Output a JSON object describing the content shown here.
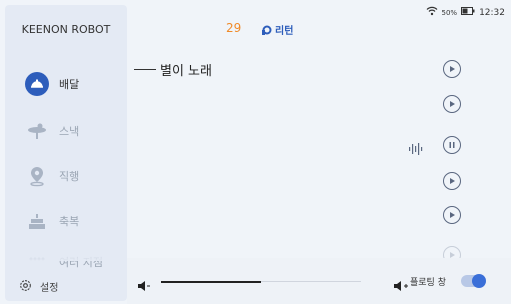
{
  "status_bar": {
    "battery": "50%",
    "time": "12:32"
  },
  "header": {
    "track_number": "29",
    "repeat_label": "리턴"
  },
  "sidebar": {
    "brand": "KEENON ROBOT",
    "items": [
      {
        "label": "배달",
        "icon": "cloche-icon",
        "active": true
      },
      {
        "label": "스낵",
        "icon": "plate-icon",
        "active": false
      },
      {
        "label": "직행",
        "icon": "location-pin-icon",
        "active": false
      },
      {
        "label": "축복",
        "icon": "cake-icon",
        "active": false
      },
      {
        "label": "여러 지점",
        "icon": "multi-point-icon",
        "active": false
      }
    ],
    "settings_label": "설정"
  },
  "playlist": {
    "current_song": "별이 노래",
    "playing_index": 2,
    "row_count": 6
  },
  "bottom_bar": {
    "volume_level": 0.5,
    "floating_window_label": "플로팅 창",
    "floating_window_enabled": true
  },
  "colors": {
    "accent": "#2d5dbb",
    "track_number": "#f08a28",
    "sidebar_bg": "#e4eaf4",
    "toggle_on": "#3a6fd8"
  }
}
